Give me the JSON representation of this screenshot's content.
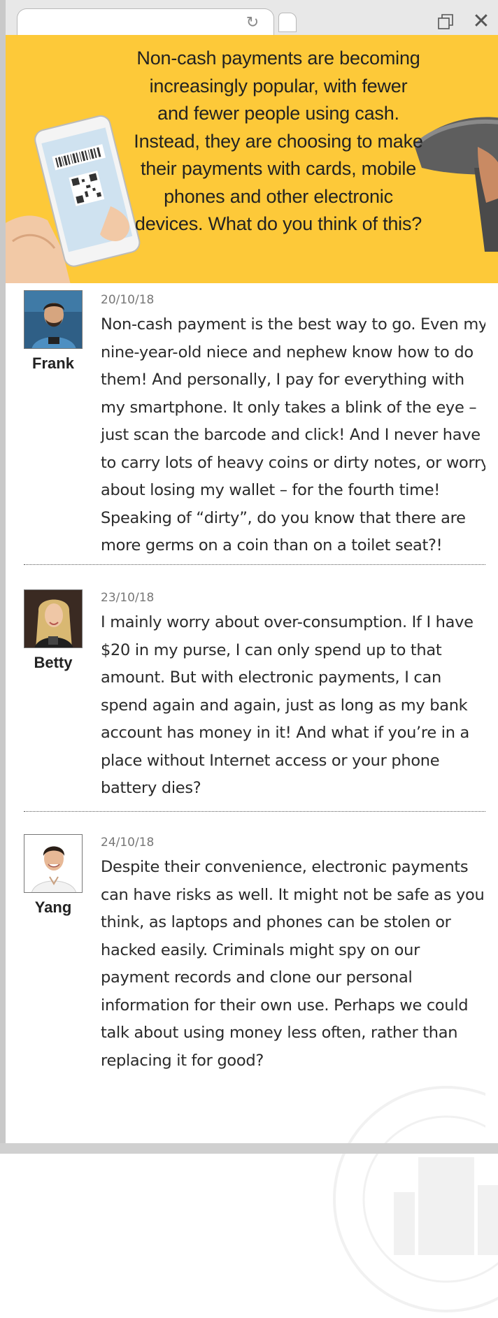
{
  "browser": {
    "reload_glyph": "↻",
    "close_glyph": "✕",
    "icons": [
      "reload-icon",
      "new-tab-icon",
      "restore-window-icon",
      "close-icon"
    ]
  },
  "banner": {
    "text": "Non-cash payments are becoming increasingly popular, with fewer and fewer people using cash. Instead, they are choosing to make their payments with cards, mobile phones and other electronic devices. What do you think of this?",
    "background": "#fdc939"
  },
  "comments": [
    {
      "author": "Frank",
      "date": "20/10/18",
      "text": "Non-cash payment is the best way to go. Even my nine-year-old niece and nephew know how to do them! And personally, I pay for everything with my smartphone. It only takes a blink of the eye – just scan the barcode and click! And I never have to carry lots of heavy coins or dirty notes, or worry about losing my wallet – for the fourth time! Speaking of “dirty”, do you know that there are more germs on a coin than on a toilet seat?!"
    },
    {
      "author": "Betty",
      "date": "23/10/18",
      "text": "I mainly worry about over-consumption. If I have $20 in my purse, I can only spend up to that amount. But with electronic payments, I can spend again and again, just as long as my bank account has money in it! And what if you’re in a place without Internet access or your phone battery dies?"
    },
    {
      "author": "Yang",
      "date": "24/10/18",
      "text": "Despite their convenience, electronic payments can have risks as well. It might not be safe as you think, as laptops and phones can be stolen or hacked easily. Criminals might spy on our payment records and clone our personal information for their own use. Perhaps we could talk about using money less often, rather than replacing it for good?"
    }
  ],
  "colors": {
    "accent": "#fdc939",
    "text": "#2a2a2a",
    "date": "#777777"
  }
}
